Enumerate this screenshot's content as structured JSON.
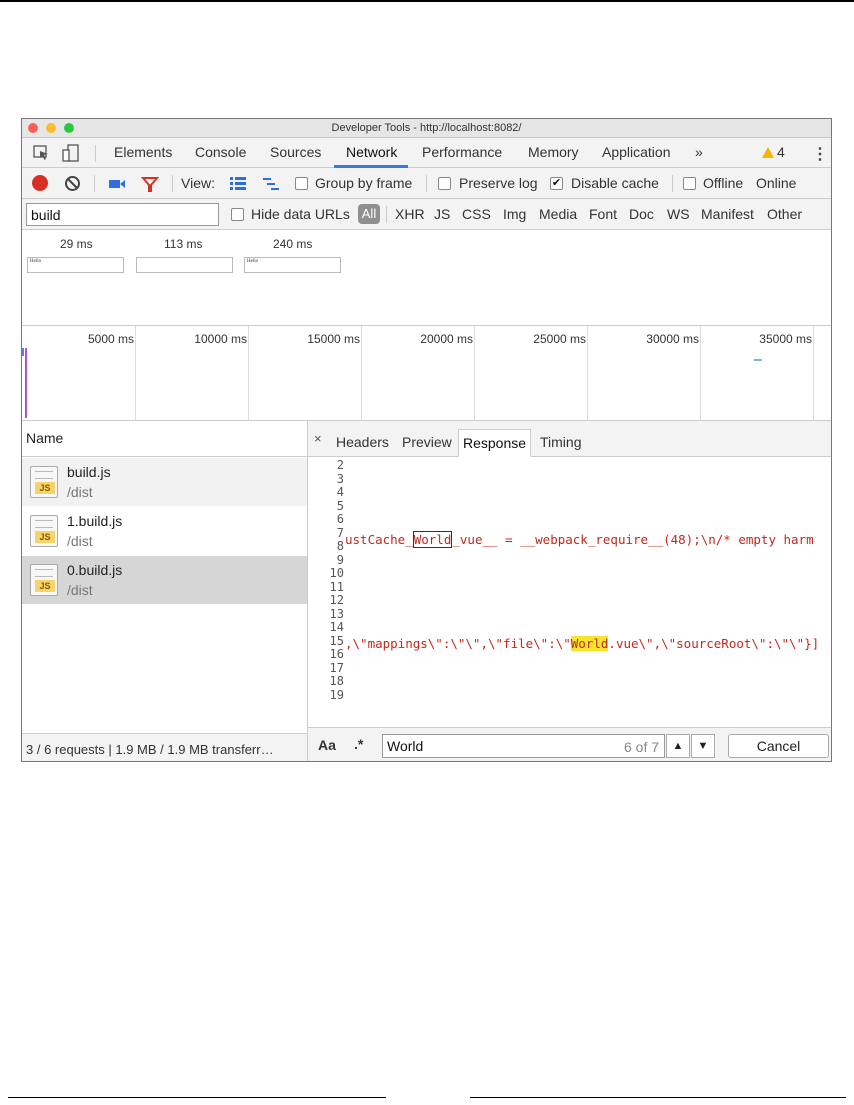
{
  "window": {
    "title": "Developer Tools - http://localhost:8082/"
  },
  "tabs": {
    "items": [
      "Elements",
      "Console",
      "Sources",
      "Network",
      "Performance",
      "Memory",
      "Application"
    ],
    "active": "Network",
    "overflow": "»",
    "warning_count": "4"
  },
  "toolbar": {
    "view_label": "View:",
    "group_by_frame": "Group by frame",
    "preserve_log": "Preserve log",
    "disable_cache": "Disable cache",
    "disable_cache_checked": true,
    "offline": "Offline",
    "throttle": "Online",
    "checkmark": "✔"
  },
  "filter": {
    "value": "build",
    "hide_data_urls": "Hide data URLs",
    "all": "All",
    "types": [
      "XHR",
      "JS",
      "CSS",
      "Img",
      "Media",
      "Font",
      "Doc",
      "WS",
      "Manifest",
      "Other"
    ]
  },
  "filmstrip": {
    "frames": [
      {
        "time": "29 ms",
        "text": "Hello"
      },
      {
        "time": "113 ms",
        "text": ""
      },
      {
        "time": "240 ms",
        "text": "Hello"
      }
    ]
  },
  "timeline": {
    "ticks": [
      "5000 ms",
      "10000 ms",
      "15000 ms",
      "20000 ms",
      "25000 ms",
      "30000 ms",
      "35000 ms"
    ]
  },
  "requests": {
    "header": "Name",
    "rows": [
      {
        "name": "build.js",
        "path": "/dist",
        "badge": "JS"
      },
      {
        "name": "1.build.js",
        "path": "/dist",
        "badge": "JS"
      },
      {
        "name": "0.build.js",
        "path": "/dist",
        "badge": "JS"
      }
    ],
    "status": "3 / 6 requests | 1.9 MB / 1.9 MB transferr…"
  },
  "detail": {
    "close": "×",
    "tabs": [
      "Headers",
      "Preview",
      "Response",
      "Timing"
    ],
    "active_tab": "Response",
    "line_numbers": [
      "2",
      "3",
      "4",
      "5",
      "6",
      "7",
      "8",
      "9",
      "10",
      "11",
      "12",
      "13",
      "14",
      "15",
      "16",
      "17",
      "18",
      "19"
    ],
    "line7": {
      "pre": "ustCache_",
      "match": "World",
      "post": "_vue__ = __webpack_require__(48);\\n/* empty harm"
    },
    "line14": {
      "pre": ",\\\"mappings\\\":\\\"\\\",\\\"file\\\":\\\"",
      "match": "World",
      "post": ".vue\\\",\\\"sourceRoot\\\":\\\"\\\"}]"
    }
  },
  "search": {
    "case_label": "Aa",
    "regex_label": ".*",
    "query": "World",
    "count": "6 of 7",
    "cancel": "Cancel"
  }
}
